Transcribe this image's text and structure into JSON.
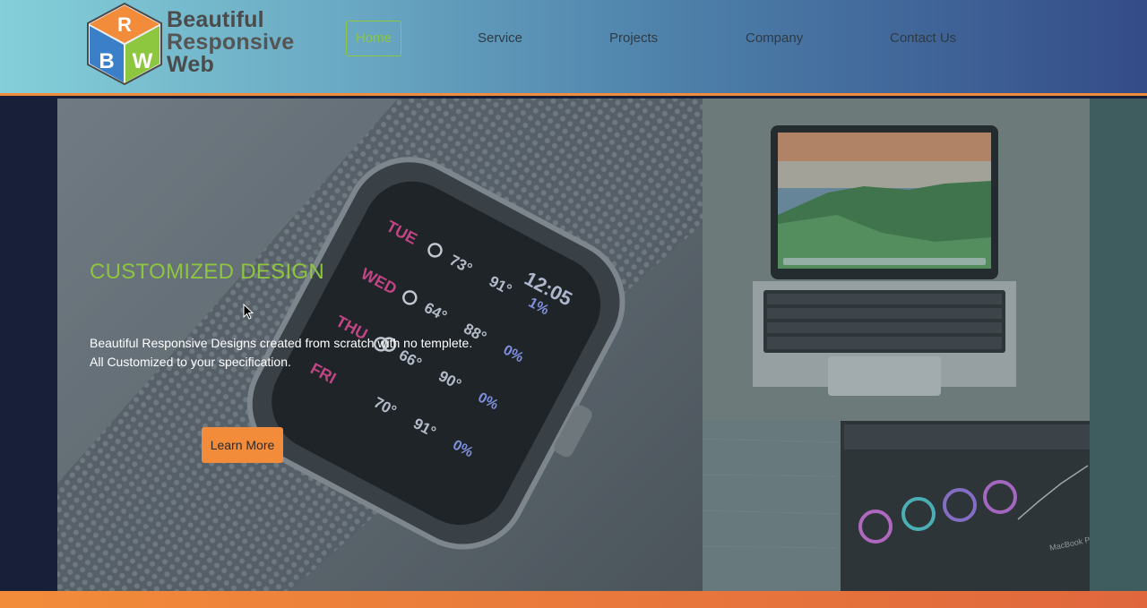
{
  "brand": {
    "line1": "Beautiful",
    "line2": "Responsive",
    "line3": "Web",
    "cube_letters": [
      "R",
      "B",
      "W"
    ],
    "colors": {
      "orange": "#f28c3a",
      "green": "#8dc63f",
      "blue": "#3a7fc8"
    }
  },
  "nav": {
    "items": [
      {
        "label": "Home",
        "active": true
      },
      {
        "label": "Service",
        "active": false
      },
      {
        "label": "Projects",
        "active": false
      },
      {
        "label": "Company",
        "active": false
      },
      {
        "label": "Contact Us",
        "active": false
      }
    ]
  },
  "hero": {
    "title": "CUSTOMIZED DESIGN",
    "desc_line1": "Beautiful Responsive Designs created from scratch with no templete.",
    "desc_line2": "All Customized to your specification.",
    "button_label": "Learn More",
    "watch": {
      "time": "12:05",
      "days": [
        {
          "day": "TUE",
          "low": "73°",
          "high": "91°",
          "rain": "1%"
        },
        {
          "day": "WED",
          "low": "64°",
          "high": "88°",
          "rain": "0%"
        },
        {
          "day": "THU",
          "low": "66°",
          "high": "90°",
          "rain": "0%"
        },
        {
          "day": "FRI",
          "low": "70°",
          "high": "91°",
          "rain": "0%"
        }
      ]
    }
  },
  "tiles": {
    "editor_caption": "MacBook Pro"
  },
  "theme": {
    "header_start": "#84cfd9",
    "header_end": "#344c88",
    "accent_orange": "#f28c3a",
    "accent_green": "#8dc63f",
    "left_side": "#181f38",
    "right_side": "#3f5c5e"
  }
}
